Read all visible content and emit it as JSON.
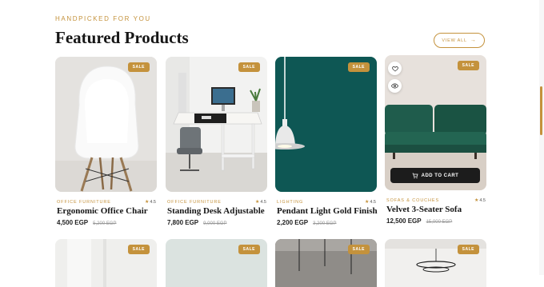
{
  "header": {
    "eyebrow": "HANDPICKED FOR YOU",
    "title": "Featured Products",
    "view_all": "VIEW ALL"
  },
  "products": [
    {
      "badge": "SALE",
      "category": "OFFICE FURNITURE",
      "rating": "4.5",
      "name": "Ergonomic Office Chair",
      "price": "4,500 EGP",
      "old_price": "5,200 EGP"
    },
    {
      "badge": "SALE",
      "category": "OFFICE FURNITURE",
      "rating": "4.5",
      "name": "Standing Desk Adjustable",
      "price": "7,800 EGP",
      "old_price": "9,000 EGP"
    },
    {
      "badge": "SALE",
      "category": "LIGHTING",
      "rating": "4.5",
      "name": "Pendant Light Gold Finish",
      "price": "2,200 EGP",
      "old_price": "3,200 EGP"
    },
    {
      "badge": "SALE",
      "category": "SOFAS & COUCHES",
      "rating": "4.5",
      "name": "Velvet 3-Seater Sofa",
      "price": "12,500 EGP",
      "old_price": "15,000 EGP",
      "add_to_cart": "ADD TO CART"
    }
  ],
  "row2": [
    {
      "badge": "SALE"
    },
    {
      "badge": "SALE"
    },
    {
      "badge": "SALE"
    },
    {
      "badge": "SALE"
    }
  ],
  "icons": {
    "heart": "heart-icon",
    "eye": "eye-icon",
    "cart": "cart-icon",
    "arrow": "arrow-right-icon",
    "star": "star-icon"
  },
  "colors": {
    "accent": "#c4923c",
    "text": "#161616",
    "button_dark": "#1c1c1c",
    "sofa_green": "#1f5c4c",
    "teal_wall": "#0f5b58"
  }
}
